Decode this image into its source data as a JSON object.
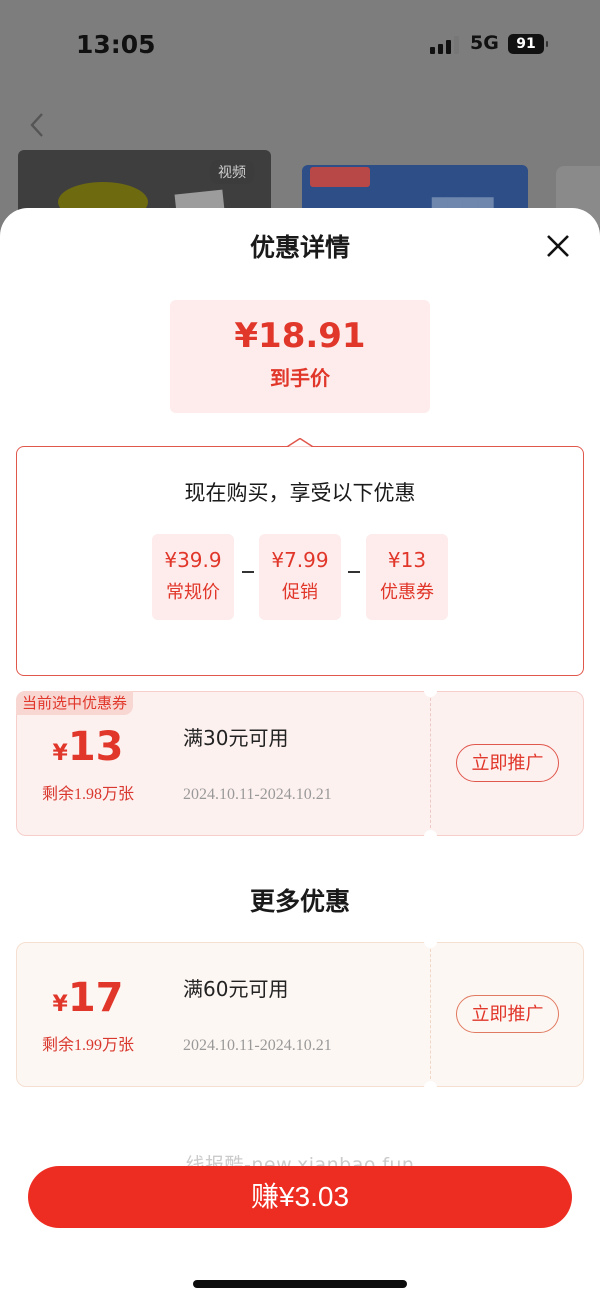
{
  "status_bar": {
    "time": "13:05",
    "network": "5G",
    "battery": "91"
  },
  "background": {
    "video_badge": "视频"
  },
  "sheet": {
    "title": "优惠详情",
    "final_price": "¥18.91",
    "final_price_label": "到手价",
    "breakdown": {
      "title": "现在购买，享受以下优惠",
      "items": [
        {
          "value": "¥39.9",
          "label": "常规价"
        },
        {
          "value": "¥7.99",
          "label": "促销"
        },
        {
          "value": "¥13",
          "label": "优惠券"
        }
      ]
    },
    "selected_coupon": {
      "tag": "当前选中优惠券",
      "currency": "¥",
      "amount": "13",
      "remaining": "剩余1.98万张",
      "condition": "满30元可用",
      "valid_dates": "2024.10.11-2024.10.21",
      "button_label": "立即推广"
    },
    "more_title": "更多优惠",
    "more_coupons": [
      {
        "currency": "¥",
        "amount": "17",
        "remaining": "剩余1.99万张",
        "condition": "满60元可用",
        "valid_dates": "2024.10.11-2024.10.21",
        "button_label": "立即推广"
      }
    ],
    "watermark": "线报酷-new.xianbao.fun",
    "earn_button_label": "赚¥3.03"
  },
  "colors": {
    "accent": "#e1362a",
    "button": "#ee2d22",
    "tint": "#fdeceb"
  }
}
